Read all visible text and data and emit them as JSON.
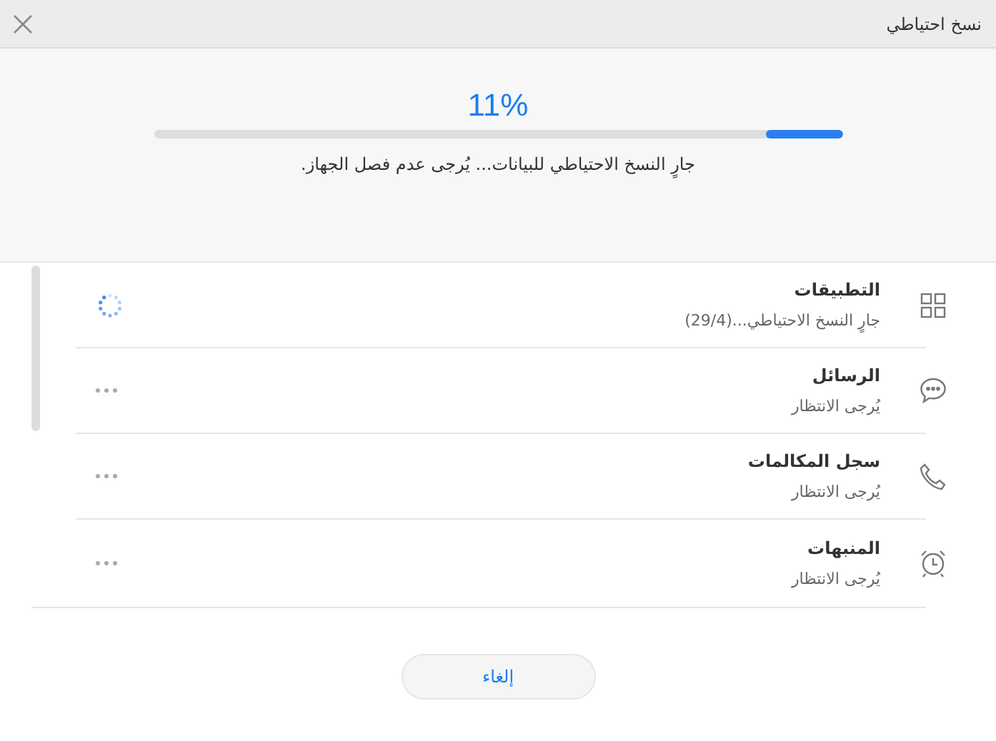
{
  "window": {
    "title": "نسخ احتياطي"
  },
  "progress": {
    "percent": "11%",
    "level": 0.11,
    "message": "جارٍ النسخ الاحتياطي للبيانات... يُرجى عدم فصل الجهاز."
  },
  "items": [
    {
      "name": "التطبيقات",
      "status": "جارٍ النسخ الاحتياطي...(29/4)",
      "kind": "active"
    },
    {
      "name": "الرسائل",
      "status": "يُرجى الانتظار",
      "kind": "waiting"
    },
    {
      "name": "سجل المكالمات",
      "status": "يُرجى الانتظار",
      "kind": "waiting"
    },
    {
      "name": "المنبهات",
      "status": "يُرجى الانتظار",
      "kind": "waiting"
    }
  ],
  "buttons": [
    "إلغاء"
  ]
}
